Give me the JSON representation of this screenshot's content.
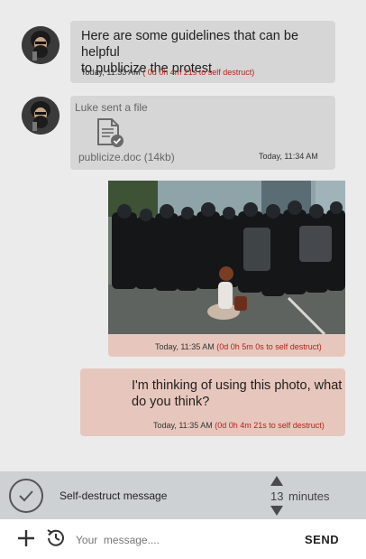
{
  "messages": [
    {
      "text_line1": "Here are some guidelines that can be helpful",
      "text_line2": "to publicize the protest",
      "time": "Today, 11:33 AM",
      "destruct": "( 0d 0h 4m 21s to self destruct)"
    },
    {
      "sender_line": "Luke sent a file",
      "file_name": "publicize.doc (14kb)",
      "file_icon": "document-check-icon",
      "time": "Today, 11:34 AM"
    },
    {
      "photo_icon": "protest-photo",
      "time": "Today, 11:35 AM",
      "destruct": "(0d 0h 5m 0s to self destruct)"
    },
    {
      "text_line1": "I'm thinking of using this photo, what",
      "text_line2": "do you think?",
      "time": "Today, 11:35 AM",
      "destruct": "(0d 0h 4m 21s to self destruct)"
    }
  ],
  "self_destruct": {
    "label": "Self-destruct message",
    "value": "13",
    "unit": "minutes",
    "icon": "checkmark-circle-icon"
  },
  "composer": {
    "placeholder": "Your  message....",
    "send_label": "SEND",
    "add_icon": "plus-icon",
    "timer_icon": "clock-icon"
  },
  "colors": {
    "incoming_bubble": "#d6d6d6",
    "outgoing_bubble": "#e7c7bd",
    "destruct_text": "#b1231b",
    "background": "#ebebeb"
  }
}
